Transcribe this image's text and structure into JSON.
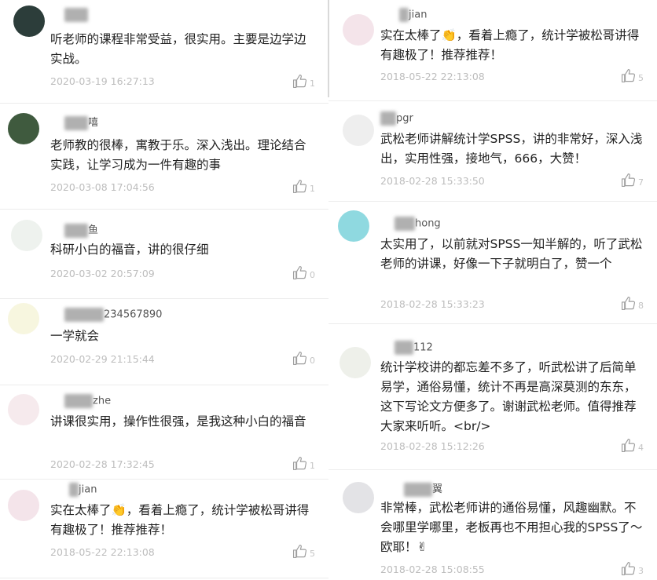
{
  "left": [
    {
      "user": "",
      "text": "听老师的课程非常受益，很实用。主要是边学边实战。",
      "date": "2020-03-19 16:27:13",
      "likes": "1",
      "avatar_color": "#2c3d3a"
    },
    {
      "user": "嘻",
      "text": "老师教的很棒，寓教于乐。深入浅出。理论结合实践，让学习成为一件有趣的事",
      "date": "2020-03-08 17:04:56",
      "likes": "1",
      "avatar_color": "#3f5a3e"
    },
    {
      "user": "鱼",
      "text": "科研小白的福音，讲的很仔细",
      "date": "2020-03-02 20:57:09",
      "likes": "0",
      "avatar_color": "#eef2ee"
    },
    {
      "user": "234567890",
      "text": "一学就会",
      "date": "2020-02-29 21:15:44",
      "likes": "0",
      "avatar_color": "#f7f6df"
    },
    {
      "user": "zhe",
      "text": "讲课很实用，操作性很强，是我这种小白的福音",
      "date": "2020-02-28 17:32:45",
      "likes": "1",
      "avatar_color": "#f6eaed"
    },
    {
      "user": "jian",
      "text": "实在太棒了👏，看着上瘾了，统计学被松哥讲得有趣极了！推荐推荐！",
      "date": "2018-05-22 22:13:08",
      "likes": "5",
      "avatar_color": "#f4e4ea"
    }
  ],
  "right": [
    {
      "user": "jian",
      "text": "实在太棒了👏，看着上瘾了，统计学被松哥讲得有趣极了！推荐推荐！",
      "date": "2018-05-22 22:13:08",
      "likes": "5",
      "avatar_color": "#f4e4ea"
    },
    {
      "user": "pgr",
      "text": "武松老师讲解统计学SPSS，讲的非常好，深入浅出，实用性强，接地气，666，大赞！",
      "date": "2018-02-28 15:33:50",
      "likes": "7",
      "avatar_color": "#eeeeee"
    },
    {
      "user": "hong",
      "text": "太实用了，以前就对SPSS一知半解的，听了武松老师的讲课，好像一下子就明白了，赞一个",
      "date": "2018-02-28 15:33:23",
      "likes": "8",
      "avatar_color": "#8fd9e0"
    },
    {
      "user": "112",
      "text": "统计学校讲的都忘差不多了，听武松讲了后简单易学，通俗易懂，统计不再是高深莫测的东东，这下写论文方便多了。谢谢武松老师。值得推荐大家来听听。<br/>",
      "date": "2018-02-28 15:12:26",
      "likes": "4",
      "avatar_color": "#eef0ea"
    },
    {
      "user": "翼",
      "text": "非常棒，武松老师讲的通俗易懂，风趣幽默。不会哪里学哪里，老板再也不用担心我的SPSS了～欧耶！✌",
      "date": "2018-02-28 15:08:55",
      "likes": "3",
      "avatar_color": "#e3e3e6"
    }
  ]
}
